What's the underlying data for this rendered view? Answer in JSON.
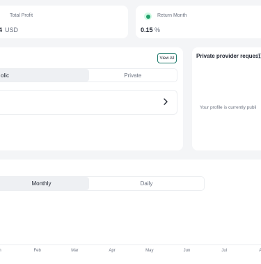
{
  "stats": {
    "total_profit": {
      "label": "Total Profit",
      "value": "4",
      "unit": "USD"
    },
    "return_month": {
      "label": "Return Month",
      "value": "0.15",
      "unit": "%"
    }
  },
  "providers": {
    "view_all_label": "View All",
    "tabs": [
      {
        "label": "olic",
        "active": true
      },
      {
        "label": "Private",
        "active": false
      }
    ]
  },
  "private_request": {
    "title": "Private provider request",
    "message": "Your profile is currently publi"
  },
  "chart": {
    "period_tabs": [
      {
        "label": "Monthly",
        "active": true
      },
      {
        "label": "Daily",
        "active": false
      }
    ]
  },
  "chart_data": {
    "type": "line",
    "x_tick_labels": [
      "n",
      "Feb",
      "Mar",
      "Apr",
      "May",
      "Jun",
      "Jul",
      "Au"
    ]
  },
  "colors": {
    "accent": "#1f7a6c",
    "success": "#22a06b",
    "background": "#f4f5f7"
  }
}
